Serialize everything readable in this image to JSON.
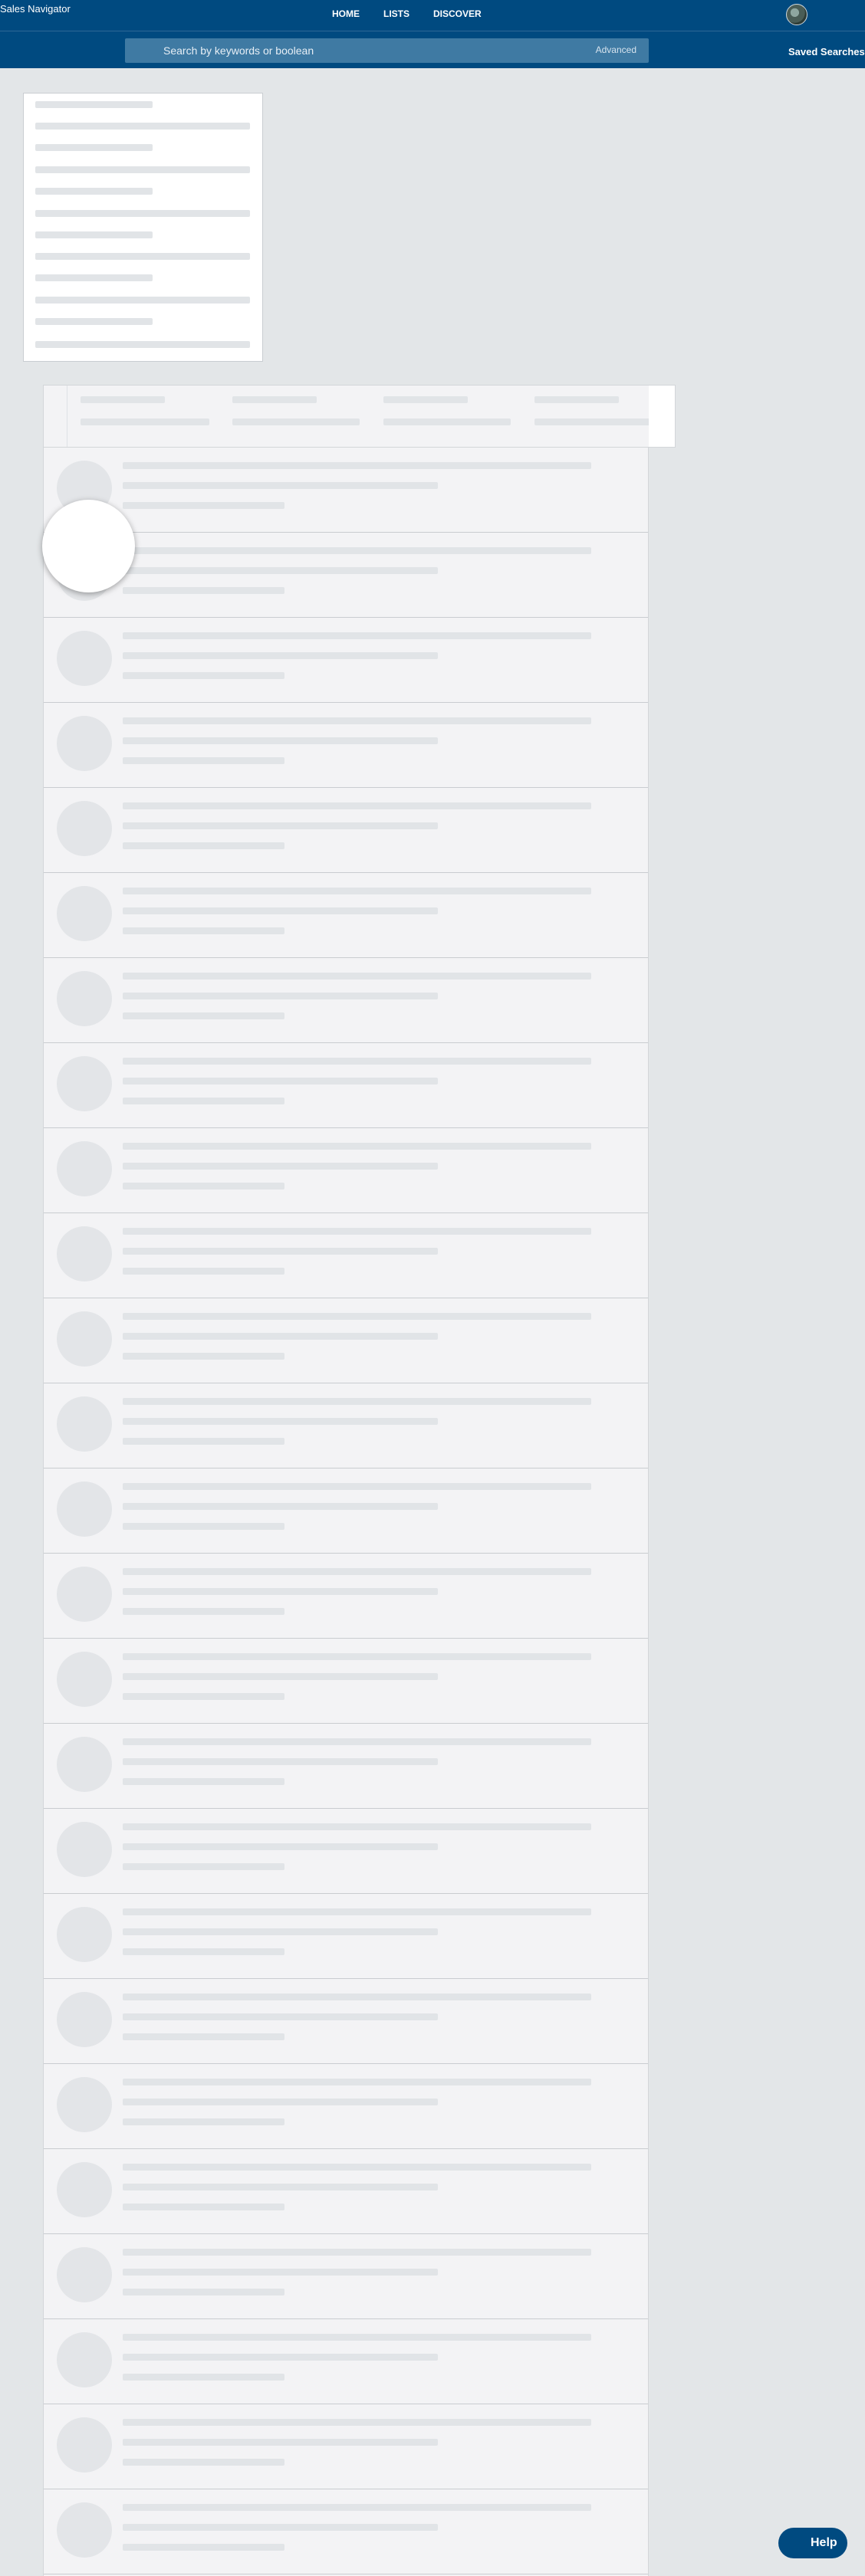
{
  "header": {
    "brand": "Sales Navigator",
    "nav": [
      {
        "label": "HOME"
      },
      {
        "label": "LISTS"
      },
      {
        "label": "DISCOVER"
      }
    ]
  },
  "search": {
    "placeholder": "Search by keywords or boolean",
    "advanced_label": "Advanced",
    "saved_label": "Saved Searches"
  },
  "help": {
    "label": "Help"
  },
  "colors": {
    "brand": "#004a80",
    "search_bg": "#3f7aa3",
    "page_bg": "#e3e6e8"
  }
}
